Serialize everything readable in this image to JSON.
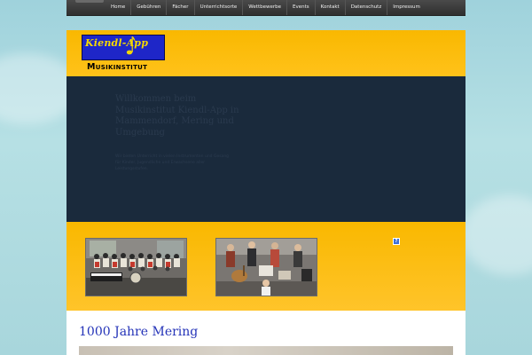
{
  "nav": {
    "items": [
      "Home",
      "Gebühren",
      "Fächer",
      "Unterrichtsorte",
      "Wettbewerbe",
      "Events",
      "Kontakt",
      "Datenschutz",
      "Impressum"
    ]
  },
  "logo": {
    "top_text": "Kiendl-App",
    "bottom_text": "Musikinstitut"
  },
  "hero": {
    "title": "Willkommen beim Musikinstitut Kiendl-App in Mammendorf, Mering und Umgebung",
    "body": "Wir bieten Unterricht in vielen Instrumenten und Gesang für Kinder, Jugendliche und Erwachsene aller Leistungsstufen."
  },
  "section": {
    "title": "1000 Jahre Mering"
  },
  "help_icon": "?",
  "colors": {
    "nav_bg": "#3a3a3a",
    "header_yellow": "#f9b800",
    "hero_bg": "#1a2a3c",
    "logo_blue": "#1e26c8",
    "title_blue": "#2433b8"
  }
}
